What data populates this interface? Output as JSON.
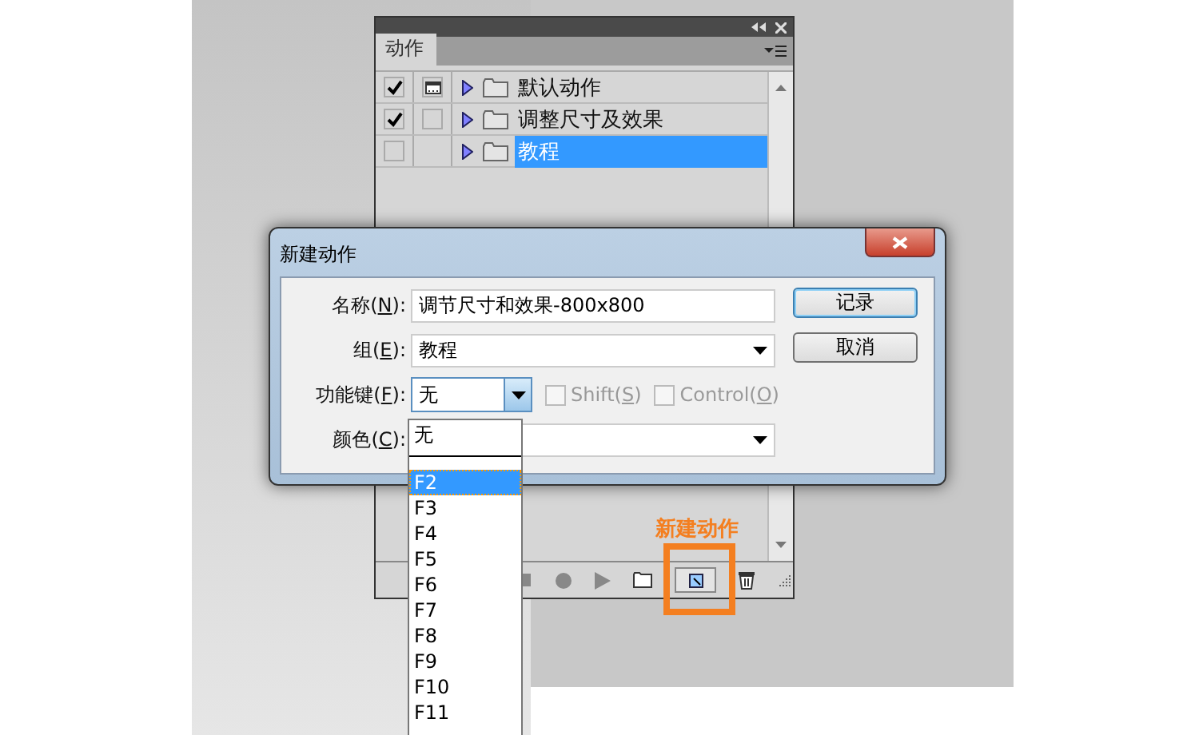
{
  "actions_panel": {
    "tab": "动作",
    "actions": [
      {
        "checked": true,
        "dialog": true,
        "label": "默认动作",
        "selected": false
      },
      {
        "checked": true,
        "dialog": false,
        "label": "调整尺寸及效果",
        "selected": false
      },
      {
        "checked": false,
        "label": "教程",
        "selected": true
      }
    ]
  },
  "dialog": {
    "title": "新建动作",
    "fields": [
      {
        "kind": "text",
        "label": {
          "before": "名称(",
          "key": "N",
          "after": "):"
        },
        "value": "调节尺寸和效果-800x800"
      },
      {
        "kind": "select",
        "label": {
          "before": "组(",
          "key": "E",
          "after": "):"
        },
        "value": "教程"
      },
      {
        "kind": "function",
        "label": {
          "before": "功能键(",
          "key": "F",
          "after": "):"
        },
        "value": "无",
        "options": [
          {
            "label": "Shift(",
            "key": "S",
            "after": ")",
            "checked": false,
            "disabled": true
          },
          {
            "label": "Control(",
            "key": "O",
            "after": ")",
            "checked": false,
            "disabled": true
          }
        ]
      },
      {
        "kind": "select",
        "label": {
          "before": "颜色(",
          "key": "C",
          "after": "):"
        }
      }
    ],
    "buttons": [
      {
        "label": "记录",
        "default": true
      },
      {
        "label": "取消",
        "default": false
      }
    ]
  },
  "function_key_list": [
    {
      "label": "无",
      "selected": false,
      "separator_after": true
    },
    {
      "label": "F2",
      "selected": true
    },
    {
      "label": "F3",
      "selected": false
    },
    {
      "label": "F4",
      "selected": false
    },
    {
      "label": "F5",
      "selected": false
    },
    {
      "label": "F6",
      "selected": false
    },
    {
      "label": "F7",
      "selected": false
    },
    {
      "label": "F8",
      "selected": false
    },
    {
      "label": "F9",
      "selected": false
    },
    {
      "label": "F10",
      "selected": false
    },
    {
      "label": "F11",
      "selected": false
    }
  ],
  "annotation": {
    "text": "新建动作"
  }
}
